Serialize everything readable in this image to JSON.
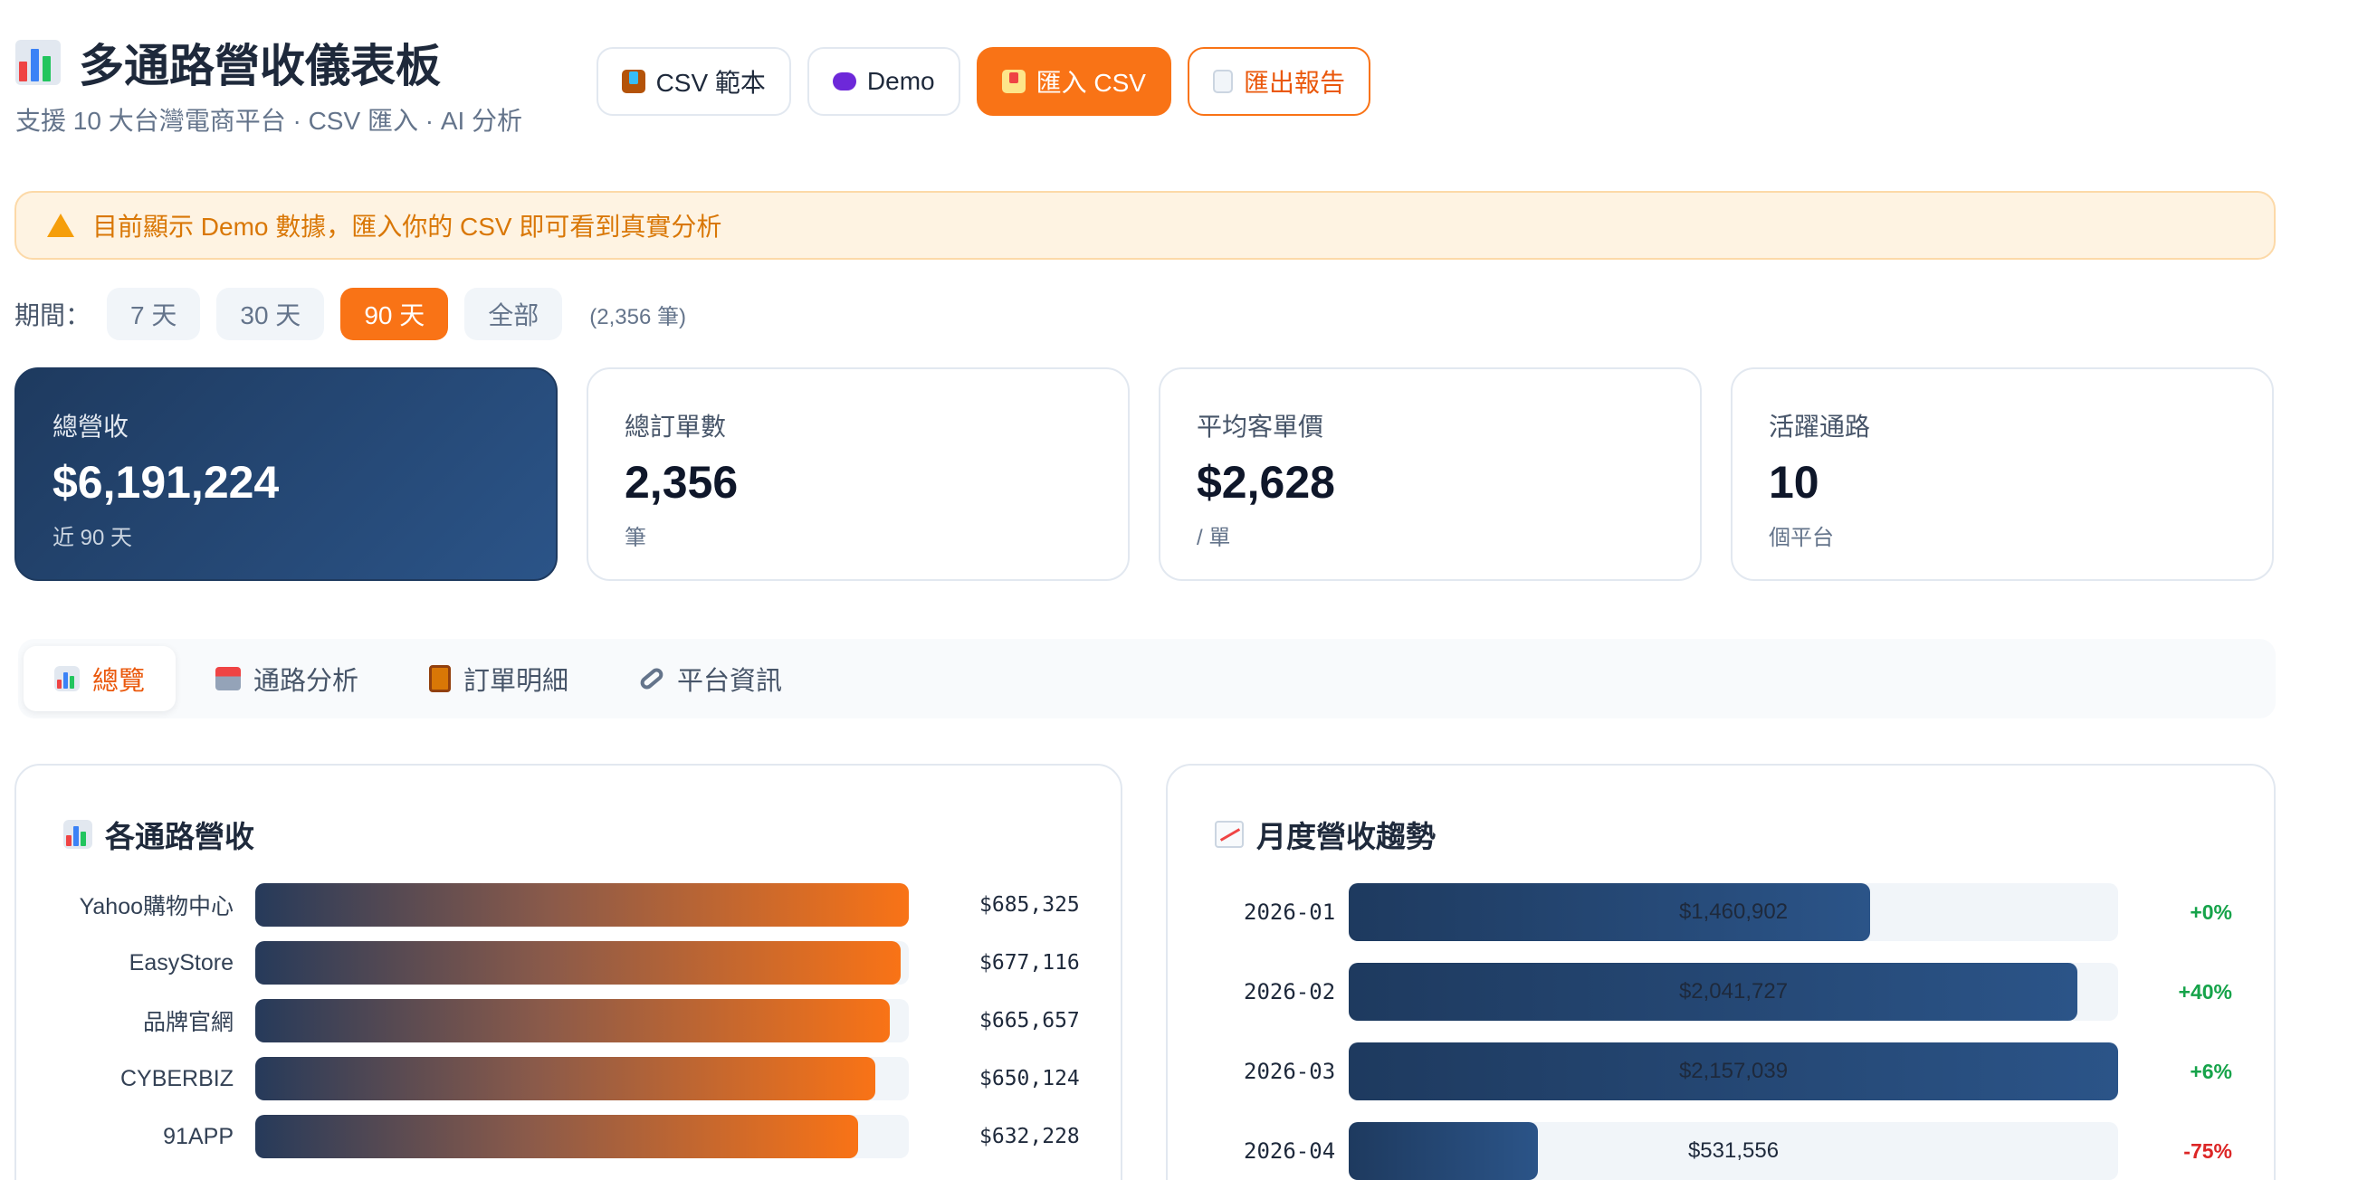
{
  "header": {
    "title": "多通路營收儀表板",
    "subtitle": "支援 10 大台灣電商平台 · CSV 匯入 · AI 分析",
    "icon": "bar-chart-icon"
  },
  "actions": {
    "csv_template": "CSV 範本",
    "demo": "Demo",
    "import_csv": "匯入 CSV",
    "export_report": "匯出報告"
  },
  "banner": {
    "text": "目前顯示 Demo 數據，匯入你的 CSV 即可看到真實分析"
  },
  "period": {
    "label": "期間：",
    "options": [
      "7 天",
      "30 天",
      "90 天",
      "全部"
    ],
    "active": "90 天",
    "count": "(2,356 筆)"
  },
  "kpis": [
    {
      "label": "總營收",
      "value": "$6,191,224",
      "sub": "近 90 天"
    },
    {
      "label": "總訂單數",
      "value": "2,356",
      "sub": "筆"
    },
    {
      "label": "平均客單價",
      "value": "$2,628",
      "sub": "/ 單"
    },
    {
      "label": "活躍通路",
      "value": "10",
      "sub": "個平台"
    }
  ],
  "tabs": [
    {
      "label": "總覽",
      "icon": "bar-chart-icon"
    },
    {
      "label": "通路分析",
      "icon": "store-icon"
    },
    {
      "label": "訂單明細",
      "icon": "clipboard-icon"
    },
    {
      "label": "平台資訊",
      "icon": "link-icon"
    }
  ],
  "channel_panel": {
    "title": "各通路營收",
    "rows": [
      {
        "name": "Yahoo購物中心",
        "value": "$685,325",
        "amount": 685325
      },
      {
        "name": "EasyStore",
        "value": "$677,116",
        "amount": 677116
      },
      {
        "name": "品牌官網",
        "value": "$665,657",
        "amount": 665657
      },
      {
        "name": "CYBERBIZ",
        "value": "$650,124",
        "amount": 650124
      },
      {
        "name": "91APP",
        "value": "$632,228",
        "amount": 632228
      }
    ]
  },
  "monthly_panel": {
    "title": "月度營收趨勢",
    "rows": [
      {
        "month": "2026-01",
        "value": "$1,460,902",
        "amount": 1460902,
        "growth": "+0%",
        "trend": "up"
      },
      {
        "month": "2026-02",
        "value": "$2,041,727",
        "amount": 2041727,
        "growth": "+40%",
        "trend": "up"
      },
      {
        "month": "2026-03",
        "value": "$2,157,039",
        "amount": 2157039,
        "growth": "+6%",
        "trend": "up"
      },
      {
        "month": "2026-04",
        "value": "$531,556",
        "amount": 531556,
        "growth": "-75%",
        "trend": "down"
      }
    ]
  },
  "colors": {
    "accent": "#f97316",
    "navy": "#1e3a5f",
    "up": "#16a34a",
    "down": "#dc2626"
  }
}
